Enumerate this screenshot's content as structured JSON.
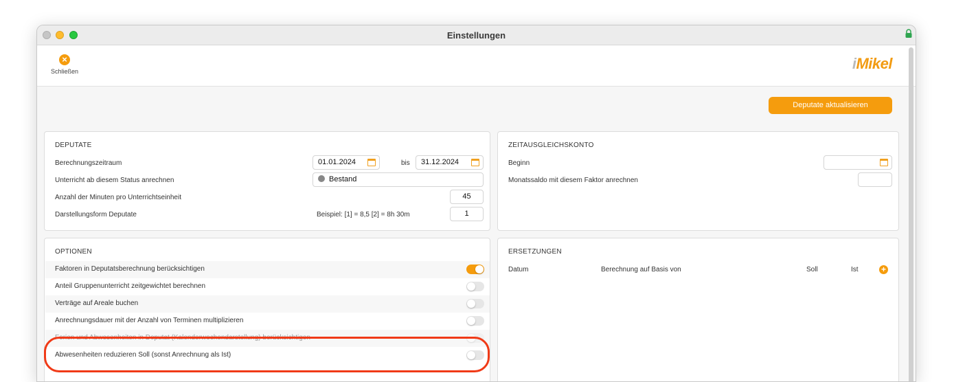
{
  "window": {
    "title": "Einstellungen"
  },
  "toolbar": {
    "close_label": "Schließen",
    "logo_i": "i",
    "logo_text": "Mikel"
  },
  "actions": {
    "update_label": "Deputate aktualisieren"
  },
  "deputate": {
    "title": "DEPUTATE",
    "period_label": "Berechnungszeitraum",
    "period_from": "01.01.2024",
    "period_to_label": "bis",
    "period_to": "31.12.2024",
    "status_label": "Unterricht ab diesem Status anrechnen",
    "status_value": "Bestand",
    "minutes_label": "Anzahl der Minuten pro Unterrichtseinheit",
    "minutes_value": "45",
    "display_label": "Darstellungsform Deputate",
    "display_example": "Beispiel:  [1] = 8,5   [2] = 8h 30m",
    "display_value": "1"
  },
  "zeitausgleich": {
    "title": "ZEITAUSGLEICHSKONTO",
    "begin_label": "Beginn",
    "begin_value": "",
    "factor_label": "Monatssaldo mit diesem Faktor anrechnen",
    "factor_value": ""
  },
  "optionen": {
    "title": "OPTIONEN",
    "items": [
      {
        "label": "Faktoren in Deputatsberechnung berücksichtigen",
        "on": true
      },
      {
        "label": "Anteil Gruppenunterricht zeitgewichtet berechnen",
        "on": false
      },
      {
        "label": "Verträge auf Areale buchen",
        "on": false
      },
      {
        "label": "Anrechnungsdauer mit der Anzahl von Terminen multiplizieren",
        "on": false
      },
      {
        "label": "Ferien und Abwesenheiten in Deputat (Kalenderwochendarstellung) berücksichtigen",
        "on": false
      },
      {
        "label": "Abwesenheiten reduzieren Soll (sonst Anrechnung als Ist)",
        "on": false
      }
    ]
  },
  "ersetzungen": {
    "title": "ERSETZUNGEN",
    "col_date": "Datum",
    "col_basis": "Berechnung auf Basis von",
    "col_soll": "Soll",
    "col_ist": "Ist"
  },
  "colors": {
    "accent": "#f59c0d",
    "highlight": "#f03a17"
  }
}
